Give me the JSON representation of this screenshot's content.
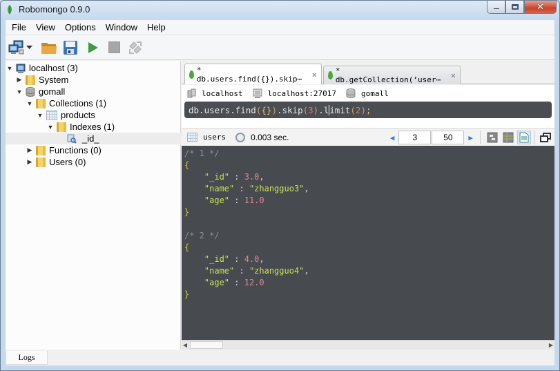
{
  "window": {
    "title": "Robomongo 0.9.0",
    "controls": {
      "minimize": "minimize",
      "maximize": "maximize",
      "close": "close"
    }
  },
  "menu": [
    "File",
    "View",
    "Options",
    "Window",
    "Help"
  ],
  "toolbar": {
    "buttons": [
      {
        "name": "connect",
        "icon": "computers-icon"
      },
      {
        "name": "connect-dropdown",
        "icon": "chevron-down-icon"
      },
      {
        "name": "open",
        "icon": "folder-open-icon"
      },
      {
        "name": "save",
        "icon": "floppy-disk-icon"
      },
      {
        "name": "execute",
        "icon": "play-icon"
      },
      {
        "name": "stop",
        "icon": "stop-icon"
      },
      {
        "name": "orientation",
        "icon": "arrows-rotate-icon"
      }
    ]
  },
  "tree": {
    "nodes": [
      {
        "label": "localhost (3)",
        "level": 0,
        "expanded": true,
        "icon": "server-icon"
      },
      {
        "label": "System",
        "level": 1,
        "expanded": false,
        "icon": "folder-icon"
      },
      {
        "label": "gomall",
        "level": 1,
        "expanded": true,
        "icon": "database-icon"
      },
      {
        "label": "Collections (1)",
        "level": 2,
        "expanded": true,
        "icon": "folder-icon"
      },
      {
        "label": "products",
        "level": 3,
        "expanded": true,
        "icon": "collection-icon"
      },
      {
        "label": "Indexes (1)",
        "level": 4,
        "expanded": true,
        "icon": "folder-icon"
      },
      {
        "label": "_id_",
        "level": 5,
        "expanded": null,
        "icon": "index-icon",
        "selected": true
      },
      {
        "label": "Functions (0)",
        "level": 2,
        "expanded": false,
        "icon": "folder-icon"
      },
      {
        "label": "Users (0)",
        "level": 2,
        "expanded": false,
        "icon": "folder-icon"
      }
    ]
  },
  "tabs": [
    {
      "label": "* db.users.find({}).skip⋯",
      "active": true
    },
    {
      "label": "* db.getCollection(‘user⋯",
      "active": false
    }
  ],
  "connection": {
    "server": "localhost",
    "address": "localhost:27017",
    "database": "gomall"
  },
  "query": {
    "text": "db.users.find({}).skip(3).limit(2);"
  },
  "results": {
    "collection": "users",
    "time": "0.003 sec.",
    "skip": "3",
    "limit": "50",
    "documents": [
      {
        "comment": "/* 1 */",
        "fields": [
          {
            "key": "\"_id\"",
            "value": "3.0",
            "type": "num"
          },
          {
            "key": "\"name\"",
            "value": "\"zhangguo3\"",
            "type": "str"
          },
          {
            "key": "\"age\"",
            "value": "11.0",
            "type": "num"
          }
        ]
      },
      {
        "comment": "/* 2 */",
        "fields": [
          {
            "key": "\"_id\"",
            "value": "4.0",
            "type": "num"
          },
          {
            "key": "\"name\"",
            "value": "\"zhangguo4\"",
            "type": "str"
          },
          {
            "key": "\"age\"",
            "value": "12.0",
            "type": "num"
          }
        ]
      }
    ]
  },
  "logs_tab": "Logs"
}
